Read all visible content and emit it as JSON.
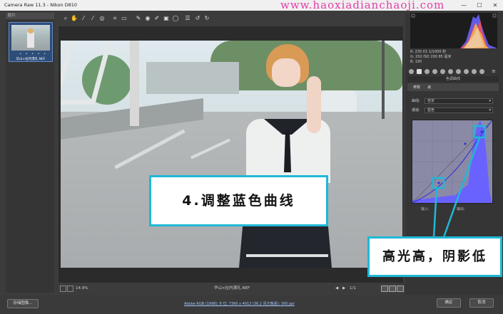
{
  "window": {
    "title": "Camera Raw 11.3 -  Nikon D810",
    "watermark": "www.haoxiadianchaoji.com",
    "controls": [
      "—",
      "☐",
      "✕"
    ]
  },
  "filmstrip": {
    "header": "胶片",
    "thumb_name": "华山×拉内漂孔.NEF",
    "stars": "• • • • •"
  },
  "statusbar": {
    "zoom": "14.9%",
    "filename": "华山×拉内漂孔.NEF",
    "page": "1/1"
  },
  "bottombar": {
    "save_label": "存储图像...",
    "info_link": "Adobe RGB (1998); 8 位; 7360 x 4912 (36.2 百万像素); 300 ppi",
    "ok_label": "确定",
    "cancel_label": "取消"
  },
  "readout": {
    "line1": "R:  235      f/1   1/1000 秒",
    "line2": "G:  202      ISO 200   85 毫米",
    "line3": "B:  195"
  },
  "panel": {
    "section_title": "色调曲线",
    "tabs": [
      "参数",
      "点"
    ],
    "curve_label": "曲线:",
    "curve_value": "自定",
    "channel_label": "通道:",
    "channel_value": "蓝色",
    "input_label": "输入:",
    "output_label": "输出:"
  },
  "callouts": {
    "step": "4.调整蓝色曲线",
    "note": "高光高，阴影低"
  },
  "colors": {
    "accent": "#1fb8d6",
    "watermark": "#e43ca8",
    "histogram_blue": "#6a62ff"
  }
}
